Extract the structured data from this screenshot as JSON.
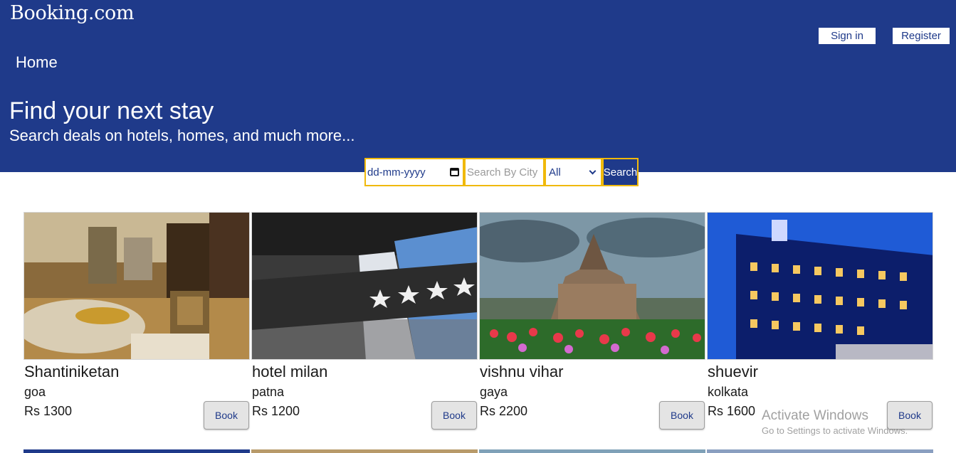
{
  "header": {
    "brand": "Booking.com",
    "nav_home": "Home",
    "sign_in": "Sign in",
    "register": "Register",
    "hero_title": "Find your next stay",
    "hero_subtitle": "Search deals on hotels, homes, and much more...",
    "bg_color": "#1f3a8a"
  },
  "search": {
    "date_placeholder": "dd-mm-yyyy",
    "city_placeholder": "Search By City",
    "type_selected": "All",
    "search_label": "Search",
    "border_color": "#f0b90b"
  },
  "hotels": [
    {
      "name": "Shantiniketan",
      "city": "goa",
      "price": "Rs 1300",
      "book_label": "Book",
      "image": "hotel-lobby-interior"
    },
    {
      "name": "hotel milan",
      "city": "patna",
      "price": "Rs 1200",
      "book_label": "Book",
      "image": "hotel-sign-stars"
    },
    {
      "name": "vishnu vihar",
      "city": "gaya",
      "price": "Rs 2200",
      "book_label": "Book",
      "image": "castle-hotel-flowers"
    },
    {
      "name": "shuevir",
      "city": "kolkata",
      "price": "Rs 1600",
      "book_label": "Book",
      "image": "blue-lit-hotel-building"
    }
  ],
  "watermark": {
    "title": "Activate Windows",
    "subtitle": "Go to Settings to activate Windows."
  }
}
